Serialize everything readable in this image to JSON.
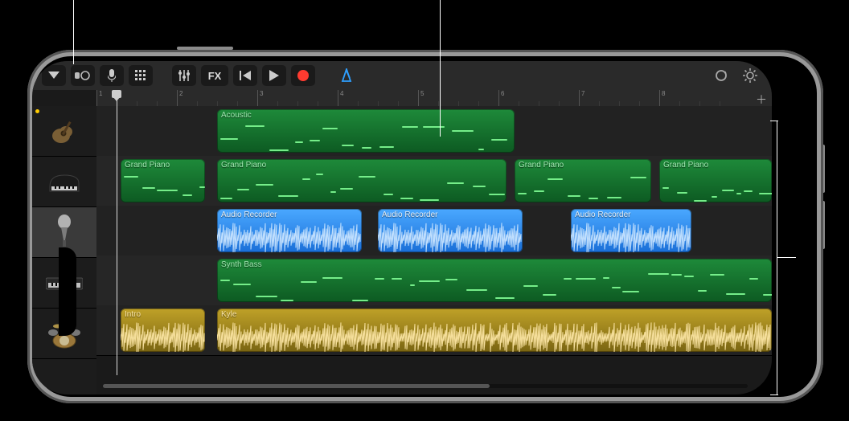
{
  "toolbar": {
    "fx_label": "FX",
    "metronome_active": true
  },
  "ruler": {
    "bars": [
      1,
      2,
      3,
      4,
      5,
      6,
      7,
      8
    ]
  },
  "playhead_bar": 1.25,
  "tracks": [
    {
      "name": "Acoustic",
      "icon": "guitar",
      "selected": false,
      "has_dot": true,
      "regions": [
        {
          "label": "Acoustic",
          "start": 1.5,
          "end": 5.2,
          "color": "green",
          "kind": "midi"
        }
      ]
    },
    {
      "name": "Grand Piano",
      "icon": "piano",
      "selected": false,
      "regions": [
        {
          "label": "Grand Piano",
          "start": 0.3,
          "end": 1.35,
          "color": "green",
          "kind": "midi"
        },
        {
          "label": "Grand Piano",
          "start": 1.5,
          "end": 5.1,
          "color": "green",
          "kind": "midi"
        },
        {
          "label": "Grand Piano",
          "start": 5.2,
          "end": 6.9,
          "color": "green",
          "kind": "midi"
        },
        {
          "label": "Grand Piano",
          "start": 7.0,
          "end": 8.4,
          "color": "green",
          "kind": "midi"
        }
      ]
    },
    {
      "name": "Audio Recorder",
      "icon": "mic",
      "selected": true,
      "regions": [
        {
          "label": "Audio Recorder",
          "start": 1.5,
          "end": 3.3,
          "color": "blue",
          "kind": "audio"
        },
        {
          "label": "Audio Recorder",
          "start": 3.5,
          "end": 5.3,
          "color": "blue",
          "kind": "audio"
        },
        {
          "label": "Audio Recorder",
          "start": 5.9,
          "end": 7.4,
          "color": "blue",
          "kind": "audio"
        }
      ]
    },
    {
      "name": "Synth Bass",
      "icon": "keyboard",
      "selected": false,
      "regions": [
        {
          "label": "Synth Bass",
          "start": 1.5,
          "end": 8.4,
          "color": "green",
          "kind": "midi"
        }
      ]
    },
    {
      "name": "Kyle",
      "icon": "drums",
      "selected": false,
      "regions": [
        {
          "label": "Intro",
          "start": 0.3,
          "end": 1.35,
          "color": "yellow",
          "kind": "audio"
        },
        {
          "label": "Kyle",
          "start": 1.5,
          "end": 8.4,
          "color": "yellow",
          "kind": "audio"
        }
      ]
    }
  ],
  "icons": {
    "browser": "browser-menu-icon",
    "instrument": "instrument-icon",
    "mic": "mic-icon",
    "grid": "grid-icon",
    "mixer": "mixer-icon",
    "fx": "fx-icon",
    "rewind": "rewind-icon",
    "play": "play-icon",
    "record": "record-icon",
    "metronome": "metronome-icon",
    "loop": "loop-icon",
    "settings": "settings-icon",
    "add": "add-track-icon"
  }
}
